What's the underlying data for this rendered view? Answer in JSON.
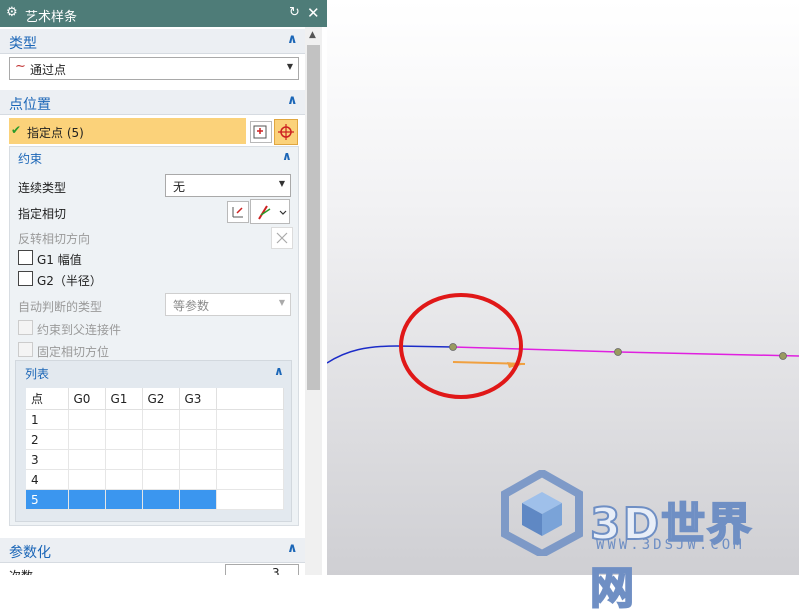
{
  "window": {
    "title": "艺术样条"
  },
  "type_section": {
    "title": "类型",
    "dropdown_value": "通过点"
  },
  "point_section": {
    "title": "点位置",
    "specify_point_label": "指定点 (5)"
  },
  "constraint_section": {
    "title": "约束",
    "continuity_label": "连续类型",
    "continuity_value": "无",
    "tangent_label": "指定相切",
    "reverse_label": "反转相切方向",
    "g1_label": "G1 幅值",
    "g2_label": "G2（半径）",
    "auto_type_label": "自动判断的类型",
    "auto_type_value": "等参数",
    "constrain_parent_label": "约束到父连接件",
    "fix_tangent_label": "固定相切方位"
  },
  "list_section": {
    "title": "列表",
    "columns": [
      "点",
      "G0",
      "G1",
      "G2",
      "G3"
    ],
    "rows": [
      "1",
      "2",
      "3",
      "4",
      "5"
    ],
    "selected_row": "5"
  },
  "param_section": {
    "title": "参数化",
    "degree_label": "次数",
    "degree_value": "3"
  },
  "watermark": {
    "brand": "3D世界网",
    "url": "WWW.3DSJW.COM"
  },
  "colors": {
    "titlebar": "#4e7c78",
    "section_text": "#1b66b7",
    "selection_highlight": "#fbd27a",
    "selected_row": "#3b96ef",
    "curve_blue": "#1c2cc8",
    "curve_magenta": "#e020e0",
    "annotation_circle": "#e01818",
    "tangent_vector": "#f0a040"
  },
  "icons": [
    "gear-icon",
    "reset-icon",
    "close-icon",
    "chevron-up-icon",
    "spline-icon",
    "checkmark-icon",
    "point-dialog-icon",
    "point-snap-icon",
    "tangent-vector-icon",
    "dropdown-arrow-icon",
    "reverse-direction-icon"
  ]
}
